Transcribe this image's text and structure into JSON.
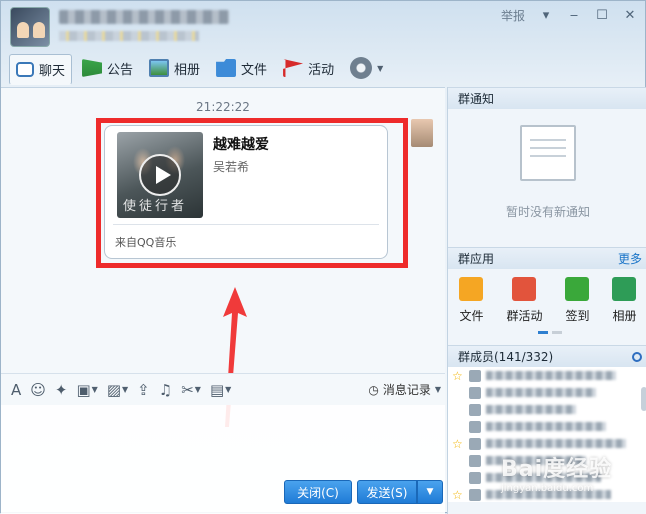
{
  "window": {
    "report_label": "举报",
    "minimize": "‒",
    "maximize": "☐",
    "close": "✕"
  },
  "toolbar": {
    "tabs": [
      {
        "label": "聊天",
        "icon": "chat-icon",
        "active": true
      },
      {
        "label": "公告",
        "icon": "notice-icon"
      },
      {
        "label": "相册",
        "icon": "album-icon"
      },
      {
        "label": "文件",
        "icon": "folder-icon"
      },
      {
        "label": "活动",
        "icon": "flag-icon"
      }
    ]
  },
  "chat": {
    "timestamp": "21:22:22",
    "music_card": {
      "song": "越难越爱",
      "artist": "吴若希",
      "source": "来自QQ音乐",
      "cover_text": "使徒行者"
    }
  },
  "editor": {
    "history_label": "消息记录"
  },
  "buttons": {
    "close": "关闭(C)",
    "send": "发送(S)"
  },
  "sidebar": {
    "notice_title": "群通知",
    "no_notice": "暂时没有新通知",
    "apps_title": "群应用",
    "more": "更多",
    "apps": [
      {
        "label": "文件",
        "icon": "folder-app-icon"
      },
      {
        "label": "群活动",
        "icon": "group-activity-icon"
      },
      {
        "label": "签到",
        "icon": "checkin-icon"
      },
      {
        "label": "相册",
        "icon": "album-app-icon"
      }
    ],
    "members_title": "群成员(141/332)"
  },
  "watermark": {
    "text": "Bai度经验",
    "url": "jingyan.baidu.com"
  }
}
